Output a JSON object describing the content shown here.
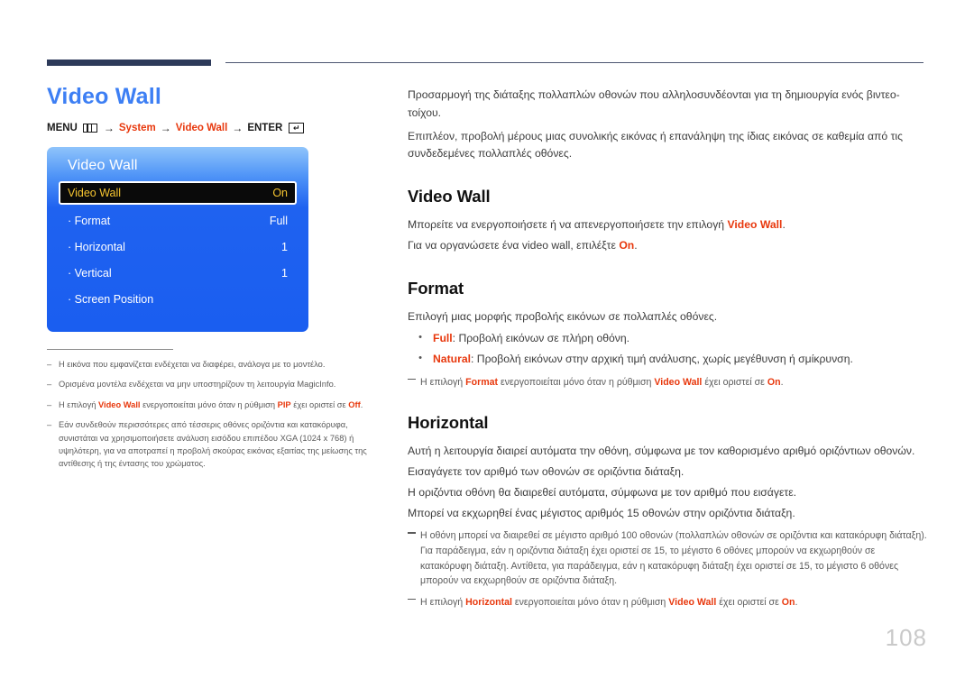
{
  "page_title": "Video Wall",
  "page_number": "108",
  "menu_path": {
    "menu_label": "MENU",
    "menu_icon": "menu-grid-icon",
    "arrow": "→",
    "item1": "System",
    "item2": "Video Wall",
    "enter_label": "ENTER",
    "enter_icon": "enter-return-icon",
    "enter_glyph": "↵"
  },
  "osd": {
    "title": "Video Wall",
    "rows": [
      {
        "label": "Video Wall",
        "value": "On",
        "selected": true,
        "sub": false
      },
      {
        "label": "Format",
        "value": "Full",
        "selected": false,
        "sub": true
      },
      {
        "label": "Horizontal",
        "value": "1",
        "selected": false,
        "sub": true
      },
      {
        "label": "Vertical",
        "value": "1",
        "selected": false,
        "sub": true
      },
      {
        "label": "Screen Position",
        "value": "",
        "selected": false,
        "sub": true
      }
    ]
  },
  "left_notes": [
    {
      "dash": "‒",
      "parts": [
        {
          "t": "Η εικόνα που εμφανίζεται ενδέχεται να διαφέρει, ανάλογα με το μοντέλο.",
          "hl": false
        }
      ]
    },
    {
      "dash": "‒",
      "parts": [
        {
          "t": "Ορισμένα μοντέλα ενδέχεται να μην υποστηρίζουν τη λειτουργία MagicInfo.",
          "hl": false
        }
      ]
    },
    {
      "dash": "‒",
      "parts": [
        {
          "t": "Η επιλογή ",
          "hl": false
        },
        {
          "t": "Video Wall",
          "hl": true
        },
        {
          "t": " ενεργοποιείται μόνο όταν η ρύθμιση ",
          "hl": false
        },
        {
          "t": "PIP",
          "hl": true
        },
        {
          "t": " έχει οριστεί σε ",
          "hl": false
        },
        {
          "t": "Off",
          "hl": true
        },
        {
          "t": ".",
          "hl": false
        }
      ]
    },
    {
      "dash": "‒",
      "parts": [
        {
          "t": "Εάν συνδεθούν περισσότερες από τέσσερις οθόνες οριζόντια και κατακόρυφα, συνιστάται να χρησιμοποιήσετε ανάλυση εισόδου επιπέδου XGA (1024 x 768) ή υψηλότερη, για να αποτραπεί η προβολή σκούρας εικόνας εξαιτίας της μείωσης της αντίθεσης ή της έντασης του χρώματος.",
          "hl": false
        }
      ]
    }
  ],
  "intro": [
    "Προσαρμογή της διάταξης πολλαπλών οθονών που αλληλοσυνδέονται για τη δημιουργία ενός βιντεο-τοίχου.",
    "Επιπλέον, προβολή μέρους μιας συνολικής εικόνας ή επανάληψη της ίδιας εικόνας σε καθεμία από τις συνδεδεμένες πολλαπλές οθόνες."
  ],
  "sections": [
    {
      "heading": "Video Wall",
      "paragraphs": [
        [
          {
            "t": "Μπορείτε να ενεργοποιήσετε ή να απενεργοποιήσετε την επιλογή ",
            "hl": false
          },
          {
            "t": "Video Wall",
            "hl": true
          },
          {
            "t": ".",
            "hl": false
          }
        ],
        [
          {
            "t": "Για να οργανώσετε ένα video wall, επιλέξτε ",
            "hl": false
          },
          {
            "t": "On",
            "hl": true
          },
          {
            "t": ".",
            "hl": false
          }
        ]
      ],
      "bullets": [],
      "notes": []
    },
    {
      "heading": "Format",
      "paragraphs": [
        [
          {
            "t": "Επιλογή μιας μορφής προβολής εικόνων σε πολλαπλές οθόνες.",
            "hl": false
          }
        ]
      ],
      "bullets": [
        {
          "dot": "•",
          "parts": [
            {
              "t": "Full",
              "hl": true
            },
            {
              "t": ": Προβολή εικόνων σε πλήρη οθόνη.",
              "hl": false
            }
          ]
        },
        {
          "dot": "•",
          "parts": [
            {
              "t": "Natural",
              "hl": true
            },
            {
              "t": ": Προβολή εικόνων στην αρχική τιμή ανάλυσης, χωρίς μεγέθυνση ή σμίκρυνση.",
              "hl": false
            }
          ]
        }
      ],
      "notes": [
        {
          "parts": [
            {
              "t": "Η επιλογή ",
              "hl": false
            },
            {
              "t": "Format",
              "hl": true
            },
            {
              "t": " ενεργοποιείται μόνο όταν η ρύθμιση ",
              "hl": false
            },
            {
              "t": "Video Wall",
              "hl": true
            },
            {
              "t": " έχει οριστεί σε ",
              "hl": false
            },
            {
              "t": "On",
              "hl": true
            },
            {
              "t": ".",
              "hl": false
            }
          ]
        }
      ]
    },
    {
      "heading": "Horizontal",
      "paragraphs": [
        [
          {
            "t": "Αυτή η λειτουργία διαιρεί αυτόματα την οθόνη, σύμφωνα με τον καθορισμένο αριθμό οριζόντιων οθονών.",
            "hl": false
          }
        ],
        [
          {
            "t": "Εισαγάγετε τον αριθμό των οθονών σε οριζόντια διάταξη.",
            "hl": false
          }
        ],
        [
          {
            "t": "Η οριζόντια οθόνη θα διαιρεθεί αυτόματα, σύμφωνα με τον αριθμό που εισάγετε.",
            "hl": false
          }
        ],
        [
          {
            "t": "Μπορεί να εκχωρηθεί ένας μέγιστος αριθμός 15 οθονών στην οριζόντια διάταξη.",
            "hl": false
          }
        ]
      ],
      "bullets": [],
      "notes": [
        {
          "parts": [
            {
              "t": "Η οθόνη μπορεί να διαιρεθεί σε μέγιστο αριθμό 100 οθονών (πολλαπλών οθονών σε οριζόντια και κατακόρυφη διάταξη). Για παράδειγμα, εάν η οριζόντια διάταξη έχει οριστεί σε 15, το μέγιστο 6 οθόνες μπορούν να εκχωρηθούν σε κατακόρυφη διάταξη. Αντίθετα, για παράδειγμα, εάν η κατακόρυφη διάταξη έχει οριστεί σε 15, το μέγιστο 6 οθόνες μπορούν να εκχωρηθούν σε οριζόντια διάταξη.",
              "hl": false
            }
          ]
        },
        {
          "parts": [
            {
              "t": "Η επιλογή ",
              "hl": false
            },
            {
              "t": "Horizontal",
              "hl": true
            },
            {
              "t": " ενεργοποιείται μόνο όταν η ρύθμιση ",
              "hl": false
            },
            {
              "t": "Video Wall",
              "hl": true
            },
            {
              "t": " έχει οριστεί σε ",
              "hl": false
            },
            {
              "t": "On",
              "hl": true
            },
            {
              "t": ".",
              "hl": false
            }
          ]
        }
      ]
    }
  ],
  "colors": {
    "title_blue": "#3d7ff4",
    "highlight_red": "#e8380d",
    "osd_blue": "#1a5ef0",
    "osd_selected_bg": "#0a0a0a",
    "osd_selected_text": "#f5c430",
    "rule_navy": "#2d3a5a",
    "page_number_gray": "#c9c9c9"
  }
}
